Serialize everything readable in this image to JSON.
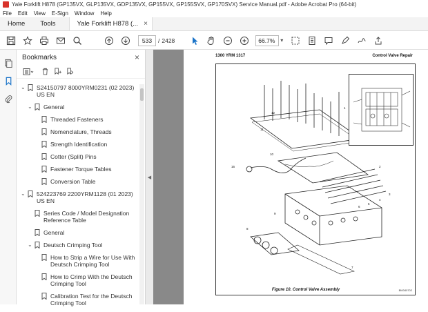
{
  "app": {
    "title": "Yale Forklift H878 (GP135VX, GLP135VX, GDP135VX, GP155VX, GP155SVX, GP170SVX) Service Manual.pdf - Adobe Acrobat Pro (64-bit)"
  },
  "menu": [
    "File",
    "Edit",
    "View",
    "E-Sign",
    "Window",
    "Help"
  ],
  "tabs": {
    "home": "Home",
    "tools": "Tools",
    "document": "Yale Forklift H878 (..."
  },
  "toolbar": {
    "icons": [
      "save-icon",
      "bookmark-star-icon",
      "print-icon",
      "email-icon",
      "search-icon",
      "prev-page-icon",
      "next-page-icon",
      "select-cursor-icon",
      "hand-icon",
      "zoom-out-icon",
      "zoom-in-icon"
    ],
    "page_current": "533",
    "page_sep": "/",
    "page_total": "2428",
    "zoom": "66.7%"
  },
  "bookmarks": {
    "title": "Bookmarks",
    "close": "×",
    "items": [
      {
        "label": "S24150797 8000YRM0231 (02 2023) US EN",
        "level": 0,
        "expanded": true
      },
      {
        "label": "General",
        "level": 1,
        "expanded": true
      },
      {
        "label": "Threaded Fasteners",
        "level": 2
      },
      {
        "label": "Nomenclature, Threads",
        "level": 2
      },
      {
        "label": "Strength Identification",
        "level": 2
      },
      {
        "label": "Cotter (Split) Pins",
        "level": 2
      },
      {
        "label": "Fastener Torque Tables",
        "level": 2
      },
      {
        "label": "Conversion Table",
        "level": 2
      },
      {
        "label": "524223769 2200YRM1128 (01 2023) US EN",
        "level": 0,
        "expanded": true
      },
      {
        "label": "Series Code / Model Designation Reference Table",
        "level": 1
      },
      {
        "label": "General",
        "level": 1
      },
      {
        "label": "Deutsch Crimping Tool",
        "level": 1,
        "expanded": true
      },
      {
        "label": "How to Strip a Wire for Use With Deutsch Crimping Tool",
        "level": 2
      },
      {
        "label": "How to Crimp With the Deutsch Crimping Tool",
        "level": 2
      },
      {
        "label": "Calibration Test for the Deutsch Crimping Tool",
        "level": 2
      }
    ]
  },
  "document": {
    "header_left": "1300 YRM 1317",
    "header_right": "Control Valve Repair",
    "caption": "Figure 10. Control Valve Assembly",
    "figure_code": "BM340702",
    "callouts": [
      "1",
      "2",
      "3",
      "4",
      "5",
      "6",
      "7",
      "8",
      "9",
      "10",
      "11",
      "12",
      "13",
      "14",
      "15",
      "16"
    ]
  }
}
